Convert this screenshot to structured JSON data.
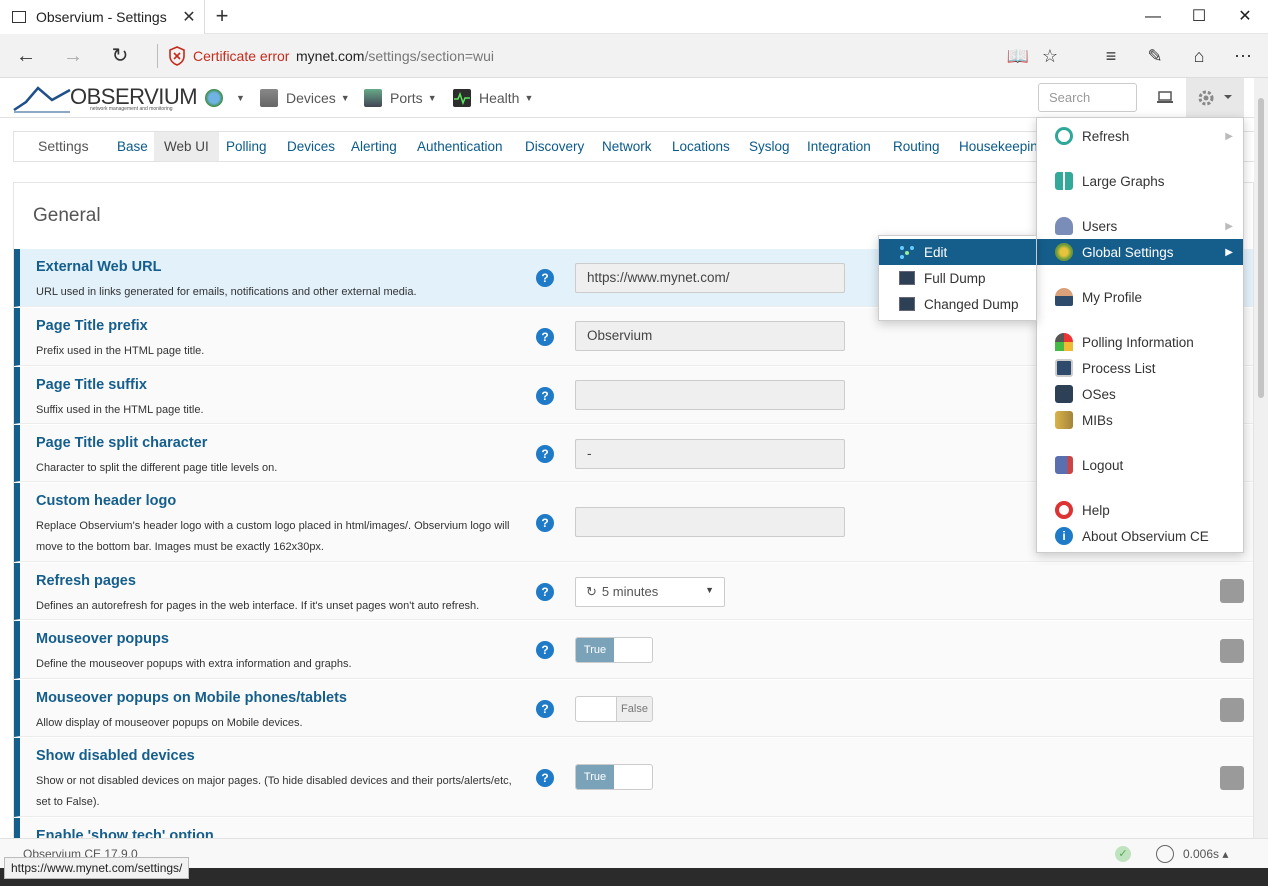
{
  "browser": {
    "tab_title": "Observium - Settings",
    "cert_error": "Certificate error",
    "url_domain": "mynet.com",
    "url_path": "/settings/section=wui",
    "status_url": "https://www.mynet.com/settings/"
  },
  "navbar": {
    "logo_text": "OBSERVIUM",
    "logo_sub": "network management and monitoring",
    "items": [
      "Devices",
      "Ports",
      "Health"
    ],
    "search_placeholder": "Search"
  },
  "subnav": {
    "title": "Settings",
    "items": [
      "Base",
      "Web UI",
      "Polling",
      "Devices",
      "Alerting",
      "Authentication",
      "Discovery",
      "Network",
      "Locations",
      "Syslog",
      "Integration",
      "Routing",
      "Housekeeping"
    ],
    "active": "Web UI"
  },
  "panel": {
    "title": "General",
    "rows": [
      {
        "title": "External Web URL",
        "desc": "URL used in links generated for emails, notifications and other external media.",
        "value": "https://www.mynet.com/"
      },
      {
        "title": "Page Title prefix",
        "desc": "Prefix used in the HTML page title.",
        "value": "Observium"
      },
      {
        "title": "Page Title suffix",
        "desc": "Suffix used in the HTML page title.",
        "value": ""
      },
      {
        "title": "Page Title split character",
        "desc": "Character to split the different page title levels on.",
        "value": "-"
      },
      {
        "title": "Custom header logo",
        "desc": "Replace Observium's header logo with a custom logo placed in html/images/. Observium logo will move to the bottom bar. Images must be exactly 162x30px.",
        "value": ""
      },
      {
        "title": "Refresh pages",
        "desc": "Defines an autorefresh for pages in the web interface. If it's unset pages won't auto refresh.",
        "value": "5 minutes"
      },
      {
        "title": "Mouseover popups",
        "desc": "Define the mouseover popups with extra information and graphs.",
        "value": "True"
      },
      {
        "title": "Mouseover popups on Mobile phones/tablets",
        "desc": "Allow display of mouseover popups on Mobile devices.",
        "value": "False"
      },
      {
        "title": "Show disabled devices",
        "desc": "Show or not disabled devices on major pages. (To hide disabled devices and their ports/alerts/etc, set to False).",
        "value": "True"
      },
      {
        "title": "Enable 'show tech' option",
        "desc": "",
        "value": ""
      }
    ],
    "help_glyph": "?"
  },
  "menu": {
    "items": [
      {
        "label": "Refresh",
        "has_sub": true
      },
      {
        "label": "Large Graphs",
        "has_sub": false
      },
      {
        "label": "Users",
        "has_sub": true
      },
      {
        "label": "Global Settings",
        "has_sub": true
      },
      {
        "label": "My Profile",
        "has_sub": false
      },
      {
        "label": "Polling Information",
        "has_sub": false
      },
      {
        "label": "Process List",
        "has_sub": false
      },
      {
        "label": "OSes",
        "has_sub": false
      },
      {
        "label": "MIBs",
        "has_sub": false
      },
      {
        "label": "Logout",
        "has_sub": false
      },
      {
        "label": "Help",
        "has_sub": false
      },
      {
        "label": "About Observium CE",
        "has_sub": false
      }
    ],
    "submenu": [
      "Edit",
      "Full Dump",
      "Changed Dump"
    ]
  },
  "footer": {
    "version": "Observium CE 17.9.0",
    "timing": "0.006s"
  },
  "colors": {
    "accent": "#155e8c",
    "help": "#1f7ac7",
    "cert_error": "#c42b1c"
  }
}
